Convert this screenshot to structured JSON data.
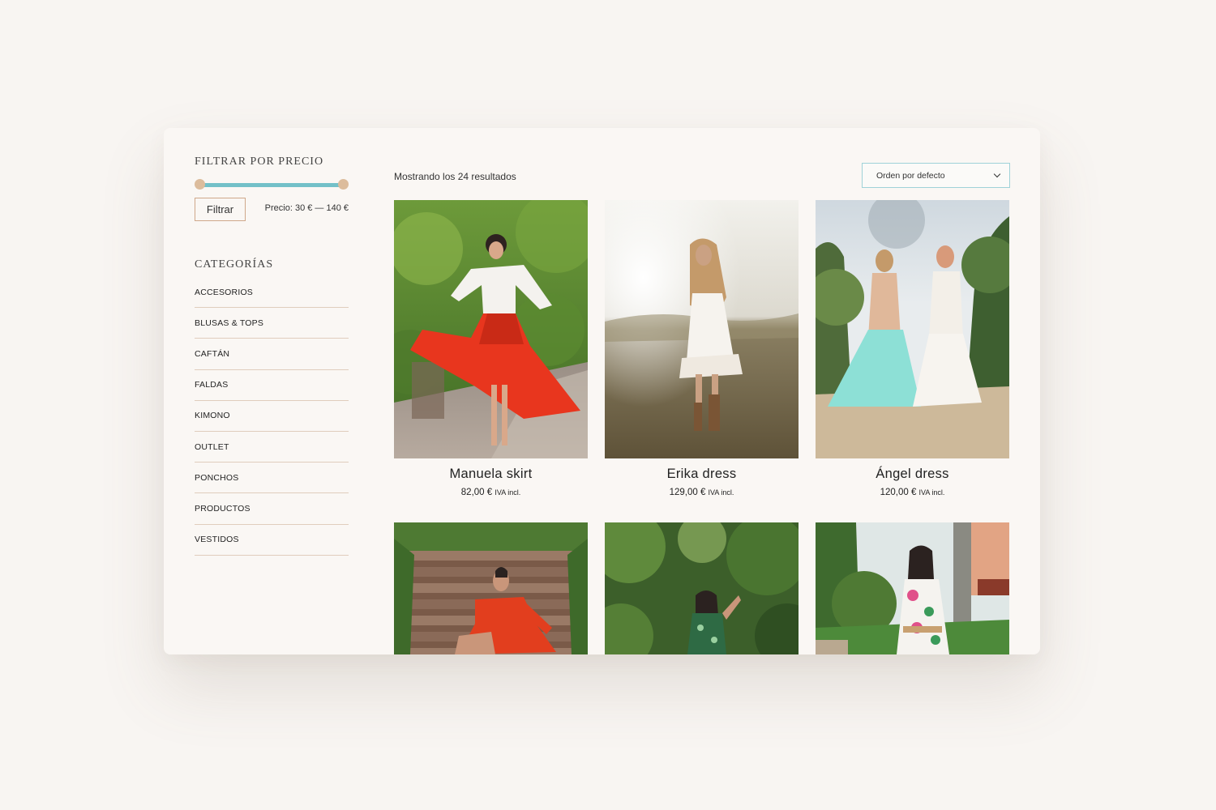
{
  "sidebar": {
    "price_filter": {
      "title": "FILTRAR POR PRECIO",
      "button_label": "Filtrar",
      "price_text": "Precio: 30 € — 140 €",
      "min": 30,
      "max": 140,
      "range_min": 30,
      "range_max": 140,
      "track_color": "#73c0c8",
      "handle_color": "#dcbc9c"
    },
    "categories": {
      "title": "CATEGORÍAS",
      "items": [
        "ACCESORIOS",
        "BLUSAS & TOPS",
        "CAFTÁN",
        "FALDAS",
        "KIMONO",
        "OUTLET",
        "PONCHOS",
        "PRODUCTOS",
        "VESTIDOS"
      ]
    }
  },
  "main": {
    "results_text": "Mostrando los 24 resultados",
    "sort": {
      "selected": "Orden por defecto"
    },
    "products": [
      {
        "name": "Manuela skirt",
        "price": "82,00 €",
        "tax": "IVA incl.",
        "image": "red-skirt-photo"
      },
      {
        "name": "Erika dress",
        "price": "129,00 €",
        "tax": "IVA incl.",
        "image": "white-dress-field-photo"
      },
      {
        "name": "Ángel dress",
        "price": "120,00 €",
        "tax": "IVA incl.",
        "image": "two-dresses-path-photo"
      },
      {
        "name": "",
        "price": "",
        "tax": "",
        "image": "red-dress-stairs-photo"
      },
      {
        "name": "",
        "price": "",
        "tax": "",
        "image": "green-dress-garden-photo"
      },
      {
        "name": "",
        "price": "",
        "tax": "",
        "image": "floral-dress-garden-photo"
      }
    ]
  },
  "colors": {
    "page_bg": "#f8f5f2",
    "card_bg": "#faf7f4",
    "divider": "#e0cdbd",
    "accent_teal": "#73c0c8",
    "accent_tan": "#dcbc9c"
  }
}
